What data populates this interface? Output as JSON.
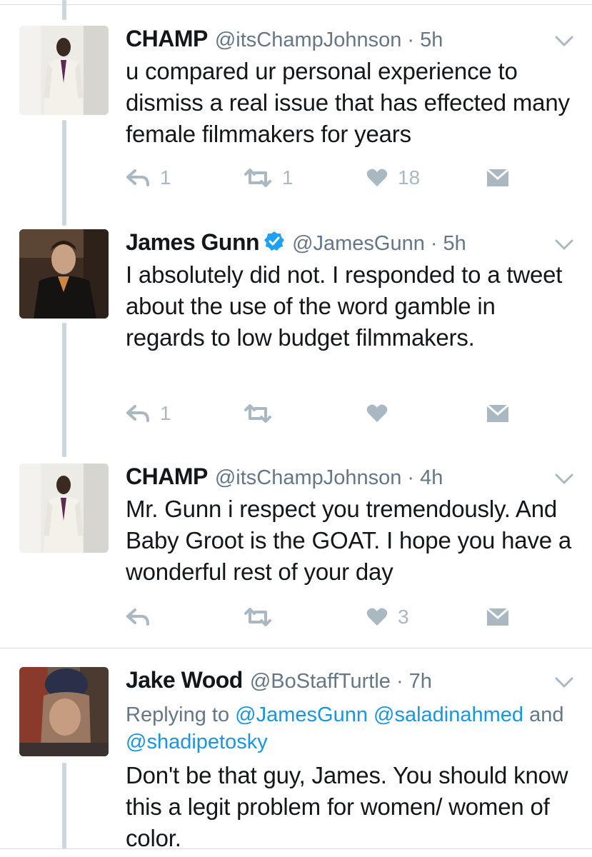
{
  "tweets": [
    {
      "name": "CHAMP",
      "handle": "@itsChampJohnson",
      "time": "5h",
      "text": "u compared ur personal experience to dismiss a real issue that has effected many female filmmakers for years",
      "reply_count": "1",
      "retweet_count": "1",
      "like_count": "18"
    },
    {
      "name": "James Gunn",
      "handle": "@JamesGunn",
      "time": "5h",
      "verified": true,
      "text": "I absolutely did not. I responded to a tweet about the use of the word gamble in regards to low budget filmmakers.",
      "reply_count": "1",
      "retweet_count": "",
      "like_count": ""
    },
    {
      "name": "CHAMP",
      "handle": "@itsChampJohnson",
      "time": "4h",
      "text": "Mr. Gunn i respect you tremendously. And Baby Groot is the GOAT. I hope you have a wonderful rest of your day",
      "reply_count": "",
      "retweet_count": "",
      "like_count": "3"
    },
    {
      "name": "Jake Wood",
      "handle": "@BoStaffTurtle",
      "time": "7h",
      "replying_prefix": "Replying to",
      "replying_mention_1": "@JamesGunn",
      "replying_mention_2": "@saladinahmed",
      "replying_and": "and",
      "replying_mention_3": "@shadipetosky",
      "text": "Don't be that guy, James. You should know this a legit problem for women/ women of color."
    }
  ],
  "separator": "·",
  "colors": {
    "text": "#14171a",
    "secondary": "#657786",
    "action_gray": "#aab8c2",
    "link": "#1b95e0",
    "verified": "#1da1f2",
    "thread_line": "#ccd6dd"
  }
}
